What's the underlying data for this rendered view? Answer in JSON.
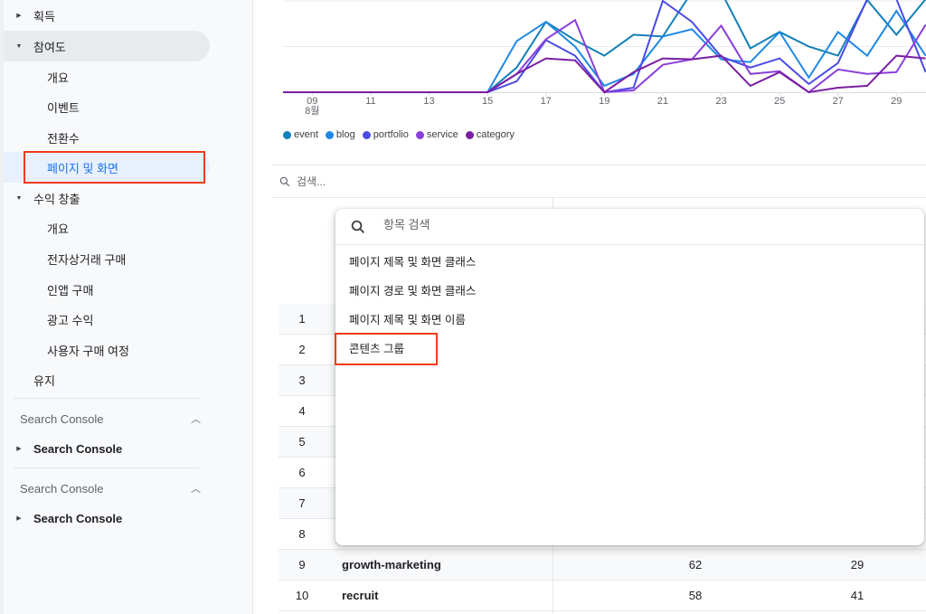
{
  "sidebar": {
    "items": [
      {
        "label": "획득",
        "type": "top",
        "expanded": false
      },
      {
        "label": "참여도",
        "type": "top",
        "expanded": true
      },
      {
        "label": "개요",
        "type": "sub"
      },
      {
        "label": "이벤트",
        "type": "sub"
      },
      {
        "label": "전환수",
        "type": "sub"
      },
      {
        "label": "페이지 및 화면",
        "type": "sub",
        "selected": true
      },
      {
        "label": "수익 창출",
        "type": "top",
        "expanded": true
      },
      {
        "label": "개요",
        "type": "sub"
      },
      {
        "label": "전자상거래 구매",
        "type": "sub"
      },
      {
        "label": "인앱 구매",
        "type": "sub"
      },
      {
        "label": "광고 수익",
        "type": "sub"
      },
      {
        "label": "사용자 구매 여정",
        "type": "sub"
      },
      {
        "label": "유지",
        "type": "top-noexpand"
      }
    ],
    "sections": [
      {
        "title": "Search Console",
        "item": "Search Console"
      },
      {
        "title": "Search Console",
        "item": "Search Console"
      }
    ],
    "colors": {
      "selected_text": "#1a73e8",
      "highlight_box": "#f23a1a"
    }
  },
  "chart_data": {
    "type": "line",
    "title": "",
    "xlabel": "",
    "ylabel": "",
    "x": [
      "08",
      "09",
      "10",
      "11",
      "12",
      "13",
      "14",
      "15",
      "16",
      "17",
      "18",
      "19",
      "20",
      "21",
      "22",
      "23",
      "24",
      "25",
      "26",
      "27",
      "28",
      "29",
      "30"
    ],
    "x_tick_labels": [
      "09",
      "11",
      "13",
      "15",
      "17",
      "19",
      "21",
      "23",
      "25",
      "27",
      "29"
    ],
    "x_month_label": "8월",
    "ylim": [
      0,
      100
    ],
    "grid": true,
    "y_tick_labels_visible": false,
    "legend_position": "bottom-left",
    "series": [
      {
        "name": "event",
        "color": "#137fb8",
        "values": [
          0,
          0,
          0,
          0,
          0,
          0,
          0,
          0,
          27,
          77,
          57,
          40,
          63,
          61,
          110,
          110,
          48,
          66,
          50,
          40,
          101,
          63,
          102
        ]
      },
      {
        "name": "blog",
        "color": "#1e88e5",
        "values": [
          0,
          0,
          0,
          0,
          0,
          0,
          0,
          0,
          56,
          77,
          50,
          7,
          20,
          61,
          69,
          36,
          33,
          66,
          16,
          66,
          40,
          89,
          40
        ]
      },
      {
        "name": "portfolio",
        "color": "#4b4be6",
        "values": [
          0,
          0,
          0,
          0,
          0,
          0,
          0,
          0,
          12,
          57,
          40,
          0,
          5,
          100,
          77,
          39,
          27,
          37,
          9,
          32,
          102,
          102,
          22
        ]
      },
      {
        "name": "service",
        "color": "#8a3fdc",
        "values": [
          0,
          0,
          0,
          0,
          0,
          0,
          0,
          0,
          20,
          58,
          79,
          0,
          2,
          30,
          36,
          73,
          20,
          23,
          0,
          25,
          20,
          22,
          74
        ]
      },
      {
        "name": "category",
        "color": "#7a1fa2",
        "values": [
          0,
          0,
          0,
          0,
          0,
          0,
          0,
          0,
          20,
          37,
          35,
          0,
          22,
          37,
          36,
          40,
          7,
          22,
          0,
          5,
          7,
          40,
          37
        ]
      }
    ]
  },
  "table": {
    "search_placeholder": "검색...",
    "rows": [
      {
        "index": "1",
        "name": "",
        "v1": "",
        "v2": ""
      },
      {
        "index": "2",
        "name": "",
        "v1": "",
        "v2": ""
      },
      {
        "index": "3",
        "name": "",
        "v1": "",
        "v2": ""
      },
      {
        "index": "4",
        "name": "",
        "v1": "",
        "v2": ""
      },
      {
        "index": "5",
        "name": "",
        "v1": "",
        "v2": ""
      },
      {
        "index": "6",
        "name": "",
        "v1": "",
        "v2": ""
      },
      {
        "index": "7",
        "name": "",
        "v1": "",
        "v2": ""
      },
      {
        "index": "8",
        "name": "",
        "v1": "",
        "v2": ""
      },
      {
        "index": "9",
        "name": "growth-marketing",
        "v1": "62",
        "v2": "29"
      },
      {
        "index": "10",
        "name": "recruit",
        "v1": "58",
        "v2": "41"
      }
    ]
  },
  "dimension_picker": {
    "search_placeholder": "항목 검색",
    "options": [
      "페이지 제목 및 화면 클래스",
      "페이지 경로 및 화면 클래스",
      "페이지 제목 및 화면 이름",
      "콘텐츠 그룹"
    ],
    "highlighted_option_index": 3
  }
}
